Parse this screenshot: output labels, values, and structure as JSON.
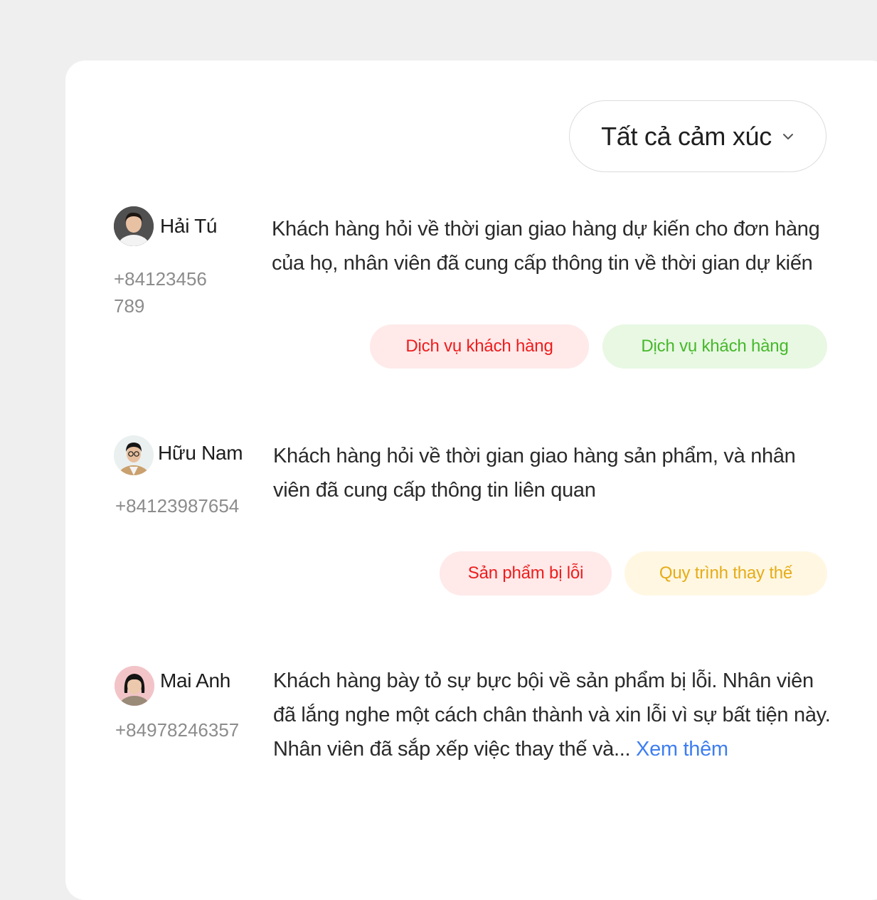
{
  "filter": {
    "label": "Tất cả cảm xúc",
    "icon": "chevron-down-icon"
  },
  "colors": {
    "negative_tag_bg": "#ffe9e9",
    "negative_tag_text": "#ee1c1c",
    "positive_tag_bg": "#e8f8e3",
    "positive_tag_text": "#46b82a",
    "neutral_tag_bg": "#fff7e2",
    "neutral_tag_text": "#e6ac17",
    "link": "#3e7ef0"
  },
  "conversations": [
    {
      "name": "Hải Tú",
      "phone": "+84123456789",
      "summary": "Khách hàng hỏi về thời gian giao hàng dự kiến cho đơn hàng của họ, nhân viên đã cung cấp thông tin về thời gian dự kiến",
      "tags": [
        {
          "label": "Dịch vụ khách hàng",
          "sentiment": "negative"
        },
        {
          "label": "Dịch vụ khách hàng",
          "sentiment": "positive"
        }
      ]
    },
    {
      "name": "Hữu Nam",
      "phone": "+84123987654",
      "summary": "Khách hàng hỏi về thời gian giao hàng sản phẩm, và nhân viên đã cung cấp thông tin liên quan",
      "tags": [
        {
          "label": "Sản phẩm bị lỗi",
          "sentiment": "negative"
        },
        {
          "label": "Quy trình thay thế",
          "sentiment": "neutral"
        }
      ]
    },
    {
      "name": "Mai Anh",
      "phone": "+84978246357",
      "summary": "Khách hàng bày tỏ sự bực bội về sản phẩm bị lỗi. Nhân viên đã lắng nghe một cách chân thành và xin lỗi vì sự bất tiện này. Nhân viên đã sắp xếp việc thay thế và...",
      "more_label": "Xem thêm",
      "tags": []
    }
  ]
}
